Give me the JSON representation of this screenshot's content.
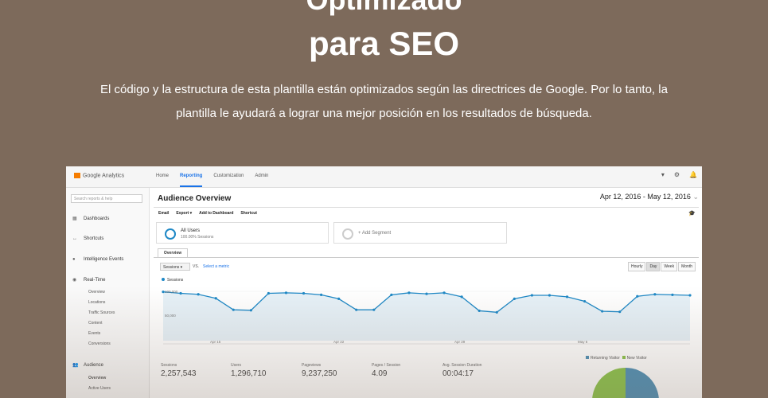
{
  "hero": {
    "title_partial": "Optimizado",
    "title": "para SEO",
    "description": "El código y la estructura de esta plantilla están optimizados según las directrices de Google. Por lo tanto, la plantilla le ayudará a lograr una mejor posición en los resultados de búsqueda."
  },
  "analytics": {
    "logo": "Google Analytics",
    "nav": [
      "Home",
      "Reporting",
      "Customization",
      "Admin"
    ],
    "active_nav": "Reporting",
    "search_placeholder": "Search reports & help",
    "sidebar": [
      {
        "icon": "dashboards-icon",
        "label": "Dashboards"
      },
      {
        "icon": "shortcuts-icon",
        "label": "Shortcuts"
      },
      {
        "icon": "intelligence-icon",
        "label": "Intelligence Events"
      },
      {
        "icon": "realtime-icon",
        "label": "Real-Time"
      },
      {
        "icon": "audience-icon",
        "label": "Audience"
      }
    ],
    "realtime_sub": [
      "Overview",
      "Locations",
      "Traffic Sources",
      "Content",
      "Events",
      "Conversions"
    ],
    "audience_sub": [
      "Overview",
      "Active Users"
    ],
    "page_title": "Audience Overview",
    "date_range": "Apr 12, 2016 - May 12, 2016",
    "toolbar": [
      "Email",
      "Export ▾",
      "Add to Dashboard",
      "Shortcut"
    ],
    "segments": [
      {
        "title": "All Users",
        "subtitle": "100.00% Sessions"
      },
      {
        "title": "+ Add Segment",
        "subtitle": ""
      }
    ],
    "tab": "Overview",
    "metric": "Sessions",
    "vs": "VS.",
    "select_metric": "Select a metric",
    "granularity": [
      "Hourly",
      "Day",
      "Week",
      "Month"
    ],
    "granularity_active": "Day",
    "legend": "Sessions",
    "y_labels": [
      "100,000",
      "50,000"
    ],
    "x_labels": [
      "Apr 15",
      "Apr 22",
      "Apr 29",
      "May 6"
    ],
    "stats": [
      {
        "label": "Sessions",
        "value": "2,257,543"
      },
      {
        "label": "Users",
        "value": "1,296,710"
      },
      {
        "label": "Pageviews",
        "value": "9,237,250"
      },
      {
        "label": "Pages / Session",
        "value": "4.09"
      },
      {
        "label": "Avg. Session Duration",
        "value": "00:04:17"
      }
    ],
    "pie_legend": [
      "Returning Visitor",
      "New Visitor"
    ],
    "colors": {
      "accent": "#1e88c6",
      "returning": "#4e8fb5",
      "new": "#8bc34a"
    }
  },
  "chart_data": {
    "type": "line",
    "series": [
      {
        "name": "Sessions",
        "values": [
          98000,
          95000,
          93000,
          85000,
          62000,
          61000,
          95000,
          96000,
          95000,
          92000,
          84000,
          62000,
          62000,
          92000,
          96000,
          94000,
          96000,
          88000,
          60000,
          57000,
          84000,
          91000,
          91000,
          88000,
          79000,
          59000,
          58000,
          89000,
          93000,
          92000,
          91000
        ]
      }
    ],
    "ylim": [
      0,
      115000
    ],
    "xlabel": "",
    "ylabel": ""
  }
}
